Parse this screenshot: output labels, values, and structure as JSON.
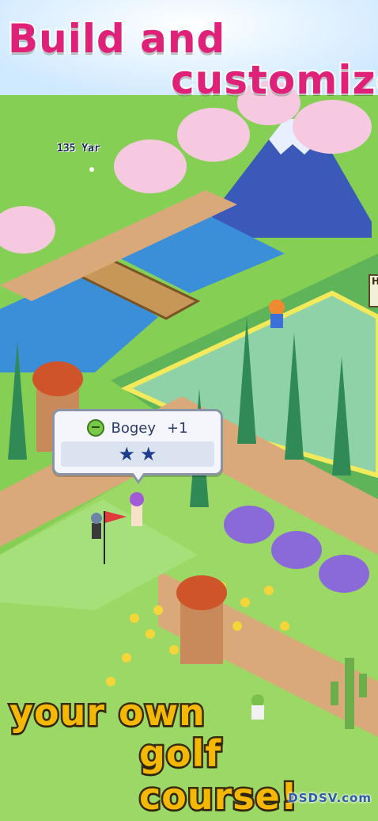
{
  "headline": {
    "line1": "Build and",
    "line2": "customize",
    "line3": "your own",
    "line4": "golf course!"
  },
  "yardage": "135 Yar",
  "score_popup": {
    "result": "Bogey",
    "score": "+1",
    "stars": [
      "★",
      "★"
    ]
  },
  "sign_text": "H",
  "watermark": "DSDSV.com",
  "colors": {
    "headline_pink": "#e0217a",
    "headline_yellow": "#f5b800",
    "grass": "#7ec850",
    "water": "#3b8fd8",
    "path": "#d9a97a"
  }
}
